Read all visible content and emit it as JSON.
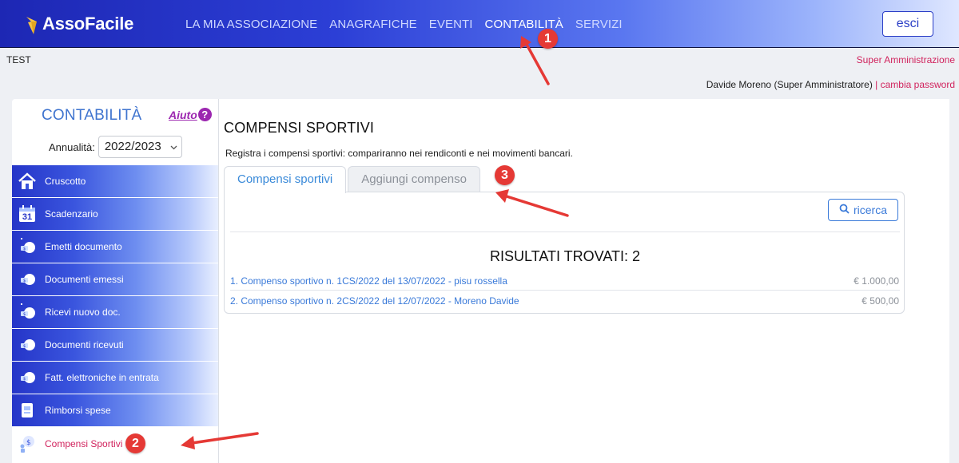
{
  "header": {
    "logo_text": "AssoFacile",
    "nav": [
      {
        "label": "LA MIA ASSOCIAZIONE",
        "active": false
      },
      {
        "label": "ANAGRAFICHE",
        "active": false
      },
      {
        "label": "EVENTI",
        "active": false
      },
      {
        "label": "CONTABILITÀ",
        "active": true
      },
      {
        "label": "SERVIZI",
        "active": false
      }
    ],
    "logout_label": "esci"
  },
  "subheader": {
    "org_name": "TEST",
    "role_link": "Super Amministrazione",
    "user": "Davide Moreno (Super Amministratore)",
    "separator": "|",
    "change_password": "cambia password"
  },
  "sidebar": {
    "title": "CONTABILITÀ",
    "help_label": "Aiuto",
    "help_icon": "?",
    "year_label": "Annualità:",
    "year_value": "2022/2023",
    "items": [
      {
        "label": "Cruscotto",
        "icon": "home-icon"
      },
      {
        "label": "Scadenzario",
        "icon": "calendar-icon",
        "icon_text": "31"
      },
      {
        "label": "Emetti documento",
        "icon": "issue-document-icon"
      },
      {
        "label": "Documenti emessi",
        "icon": "issued-documents-icon"
      },
      {
        "label": "Ricevi nuovo doc.",
        "icon": "receive-document-icon"
      },
      {
        "label": "Documenti ricevuti",
        "icon": "received-documents-icon"
      },
      {
        "label": "Fatt. elettroniche in entrata",
        "icon": "einvoice-icon"
      },
      {
        "label": "Rimborsi spese",
        "icon": "reimbursement-icon"
      },
      {
        "label": "Compensi Sportivi",
        "icon": "sport-compensation-icon",
        "active": true
      }
    ]
  },
  "main": {
    "title": "COMPENSI SPORTIVI",
    "description": "Registra i compensi sportivi: compariranno nei rendiconti e nei movimenti bancari.",
    "tabs": [
      {
        "label": "Compensi sportivi",
        "active": true
      },
      {
        "label": "Aggiungi compenso",
        "active": false
      }
    ],
    "search_label": "ricerca",
    "results_title": "RISULTATI TROVATI: 2",
    "results": [
      {
        "label": "1. Compenso sportivo n. 1CS/2022 del 13/07/2022 - pisu rossella",
        "amount": "€ 1.000,00"
      },
      {
        "label": "2. Compenso sportivo n. 2CS/2022 del 12/07/2022 - Moreno Davide",
        "amount": "€ 500,00"
      }
    ]
  },
  "annotations": [
    {
      "number": "1",
      "color": "#e53935"
    },
    {
      "number": "2",
      "color": "#e53935"
    },
    {
      "number": "3",
      "color": "#e53935"
    }
  ]
}
